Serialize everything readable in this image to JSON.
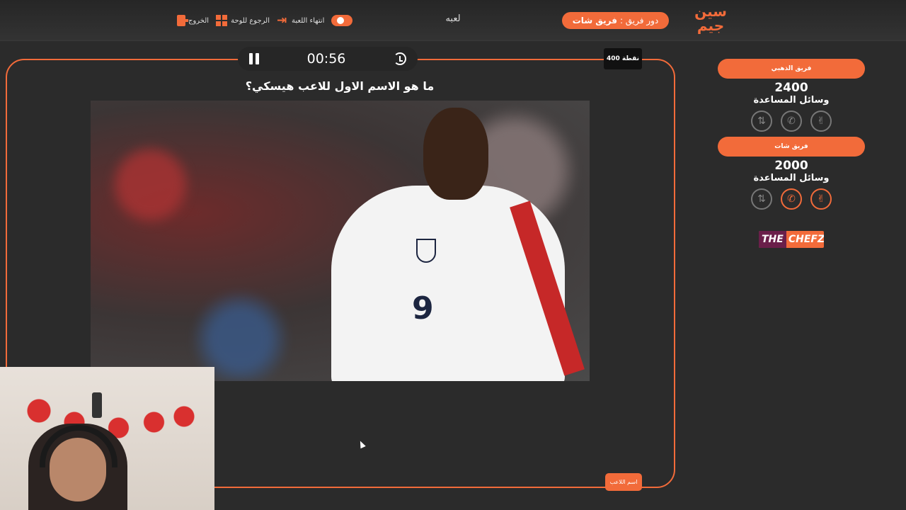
{
  "header": {
    "logo_text": "سين جيم",
    "turn_label": "دور فريق :",
    "turn_team": "فريق شات",
    "game_title": "لعبه",
    "tools": {
      "exit_label": "الخروج",
      "board_label": "الرجوع للوحة",
      "end_label": "انتهاء اللعبة"
    }
  },
  "question": {
    "timer": "00:56",
    "points": "400 نقطة",
    "text": "ما هو الاسم الاول للاعب هيسكي؟",
    "answer_button": "اسم اللاعب",
    "image_shirt_number": "9"
  },
  "teams": [
    {
      "name": "فريق الذهبي",
      "score": "2400",
      "aids_label": "وسائل المساعدة",
      "aids": [
        "swap-icon",
        "phone-icon",
        "hand-icon"
      ],
      "aids_active": [
        false,
        false,
        false
      ]
    },
    {
      "name": "فريق شات",
      "score": "2000",
      "aids_label": "وسائل المساعدة",
      "aids": [
        "swap-icon",
        "phone-icon",
        "hand-icon"
      ],
      "aids_active": [
        false,
        true,
        true
      ]
    }
  ],
  "sponsor": {
    "part1": "THE",
    "part2": "CHEFZ"
  },
  "colors": {
    "accent": "#f26b3a",
    "background": "#2b2b2b"
  }
}
